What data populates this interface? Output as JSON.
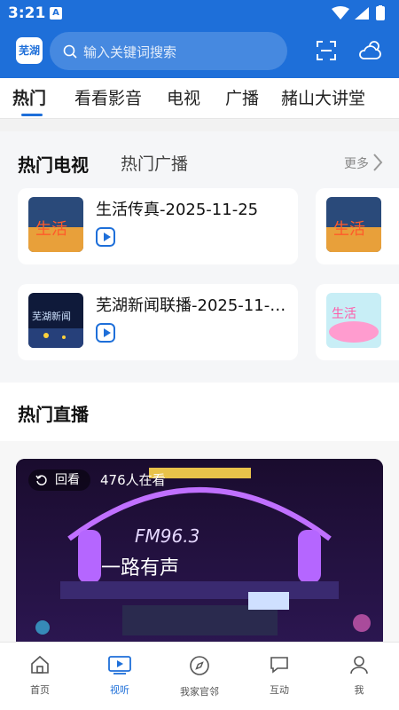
{
  "status": {
    "time": "3:21",
    "sim": "A"
  },
  "header": {
    "logo_text": "芜湖",
    "search_placeholder": "输入关键词搜索"
  },
  "tabs": [
    {
      "label": "热门"
    },
    {
      "label": "看看影音"
    },
    {
      "label": "电视"
    },
    {
      "label": "广播"
    },
    {
      "label": "赭山大讲堂"
    }
  ],
  "hot": {
    "tab_tv": "热门电视",
    "tab_radio": "热门广播",
    "more": "更多",
    "items": [
      {
        "title": "生活传真-2025-11-25"
      },
      {
        "title": "芜湖新闻联播-2025-11-25"
      }
    ]
  },
  "live": {
    "section_title": "热门直播",
    "replay": "回看",
    "viewers": "476人在看"
  },
  "bottom_nav": [
    {
      "label": "首页",
      "icon": "home-icon"
    },
    {
      "label": "视听",
      "icon": "video-icon"
    },
    {
      "label": "我家官邻",
      "icon": "compass-icon"
    },
    {
      "label": "互动",
      "icon": "interact-icon"
    },
    {
      "label": "我",
      "icon": "user-icon"
    }
  ],
  "colors": {
    "brand": "#1e6fd9",
    "text": "#111111",
    "muted": "#888888"
  }
}
